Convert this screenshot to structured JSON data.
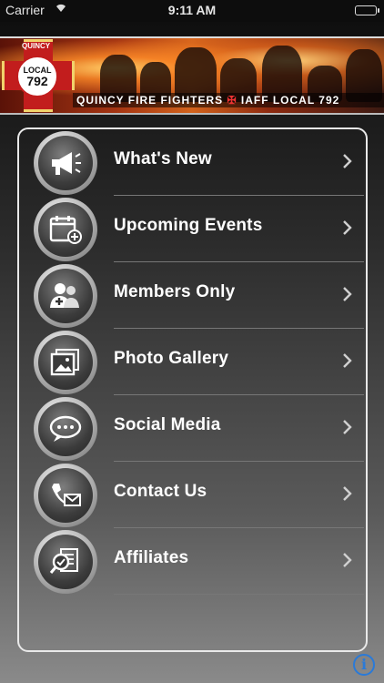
{
  "status_bar": {
    "carrier": "Carrier",
    "time": "9:11 AM"
  },
  "banner": {
    "logo_top": "QUINCY",
    "logo_line1": "LOCAL",
    "logo_line2": "792",
    "tagline": "QUINCY FIRE FIGHTERS",
    "tagline2": "IAFF LOCAL 792"
  },
  "menu": {
    "items": [
      {
        "label": "What's New",
        "icon": "megaphone-icon"
      },
      {
        "label": "Upcoming Events",
        "icon": "calendar-icon"
      },
      {
        "label": "Members Only",
        "icon": "members-icon"
      },
      {
        "label": "Photo Gallery",
        "icon": "photo-icon"
      },
      {
        "label": "Social Media",
        "icon": "chat-bubbles-icon"
      },
      {
        "label": "Contact Us",
        "icon": "phone-mail-icon"
      },
      {
        "label": "Affiliates",
        "icon": "magnifier-document-icon"
      }
    ]
  },
  "info_button": {
    "label": "i"
  }
}
